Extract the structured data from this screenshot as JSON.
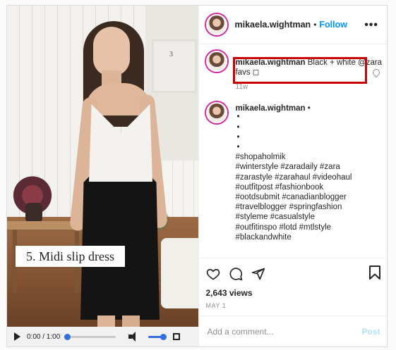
{
  "post": {
    "username": "mikaela.wightman",
    "follow_label": "Follow",
    "separator": "•",
    "more_label": "•••"
  },
  "video": {
    "overlay_caption": "5. Midi slip dress",
    "time_display": "0:00 / 1:00",
    "progress_fraction": 0,
    "volume_fraction": 1,
    "frame_number": "3"
  },
  "caption": {
    "username": "mikaela.wightman",
    "text": "Black + white @zara favs ◻",
    "age": "11w"
  },
  "comment": {
    "username": "mikaela.wightman",
    "separator": "•",
    "bullets": [
      "•",
      "•",
      "•",
      "•"
    ],
    "hashtag_lines": [
      "#shopaholmik",
      "#winterstyle #zaradaily #zara",
      "#zarastyle #zarahaul #videohaul",
      "#outfitpost #fashionbook",
      "#ootdsubmit #canadianblogger",
      "#travelblogger #springfashion",
      "#styleme #casualstyle",
      "#outfitinspo #lotd #mtlstyle",
      "#blackandwhite"
    ]
  },
  "actions": {
    "views": "2,643 views",
    "date": "MAY 1",
    "icons": [
      "heart-icon",
      "comment-icon",
      "share-icon",
      "bookmark-icon"
    ]
  },
  "composer": {
    "placeholder": "Add a comment...",
    "post_label": "Post"
  },
  "colors": {
    "link": "#0095f6",
    "highlight_box": "#cc0000",
    "player_accent": "#2f6fde"
  }
}
